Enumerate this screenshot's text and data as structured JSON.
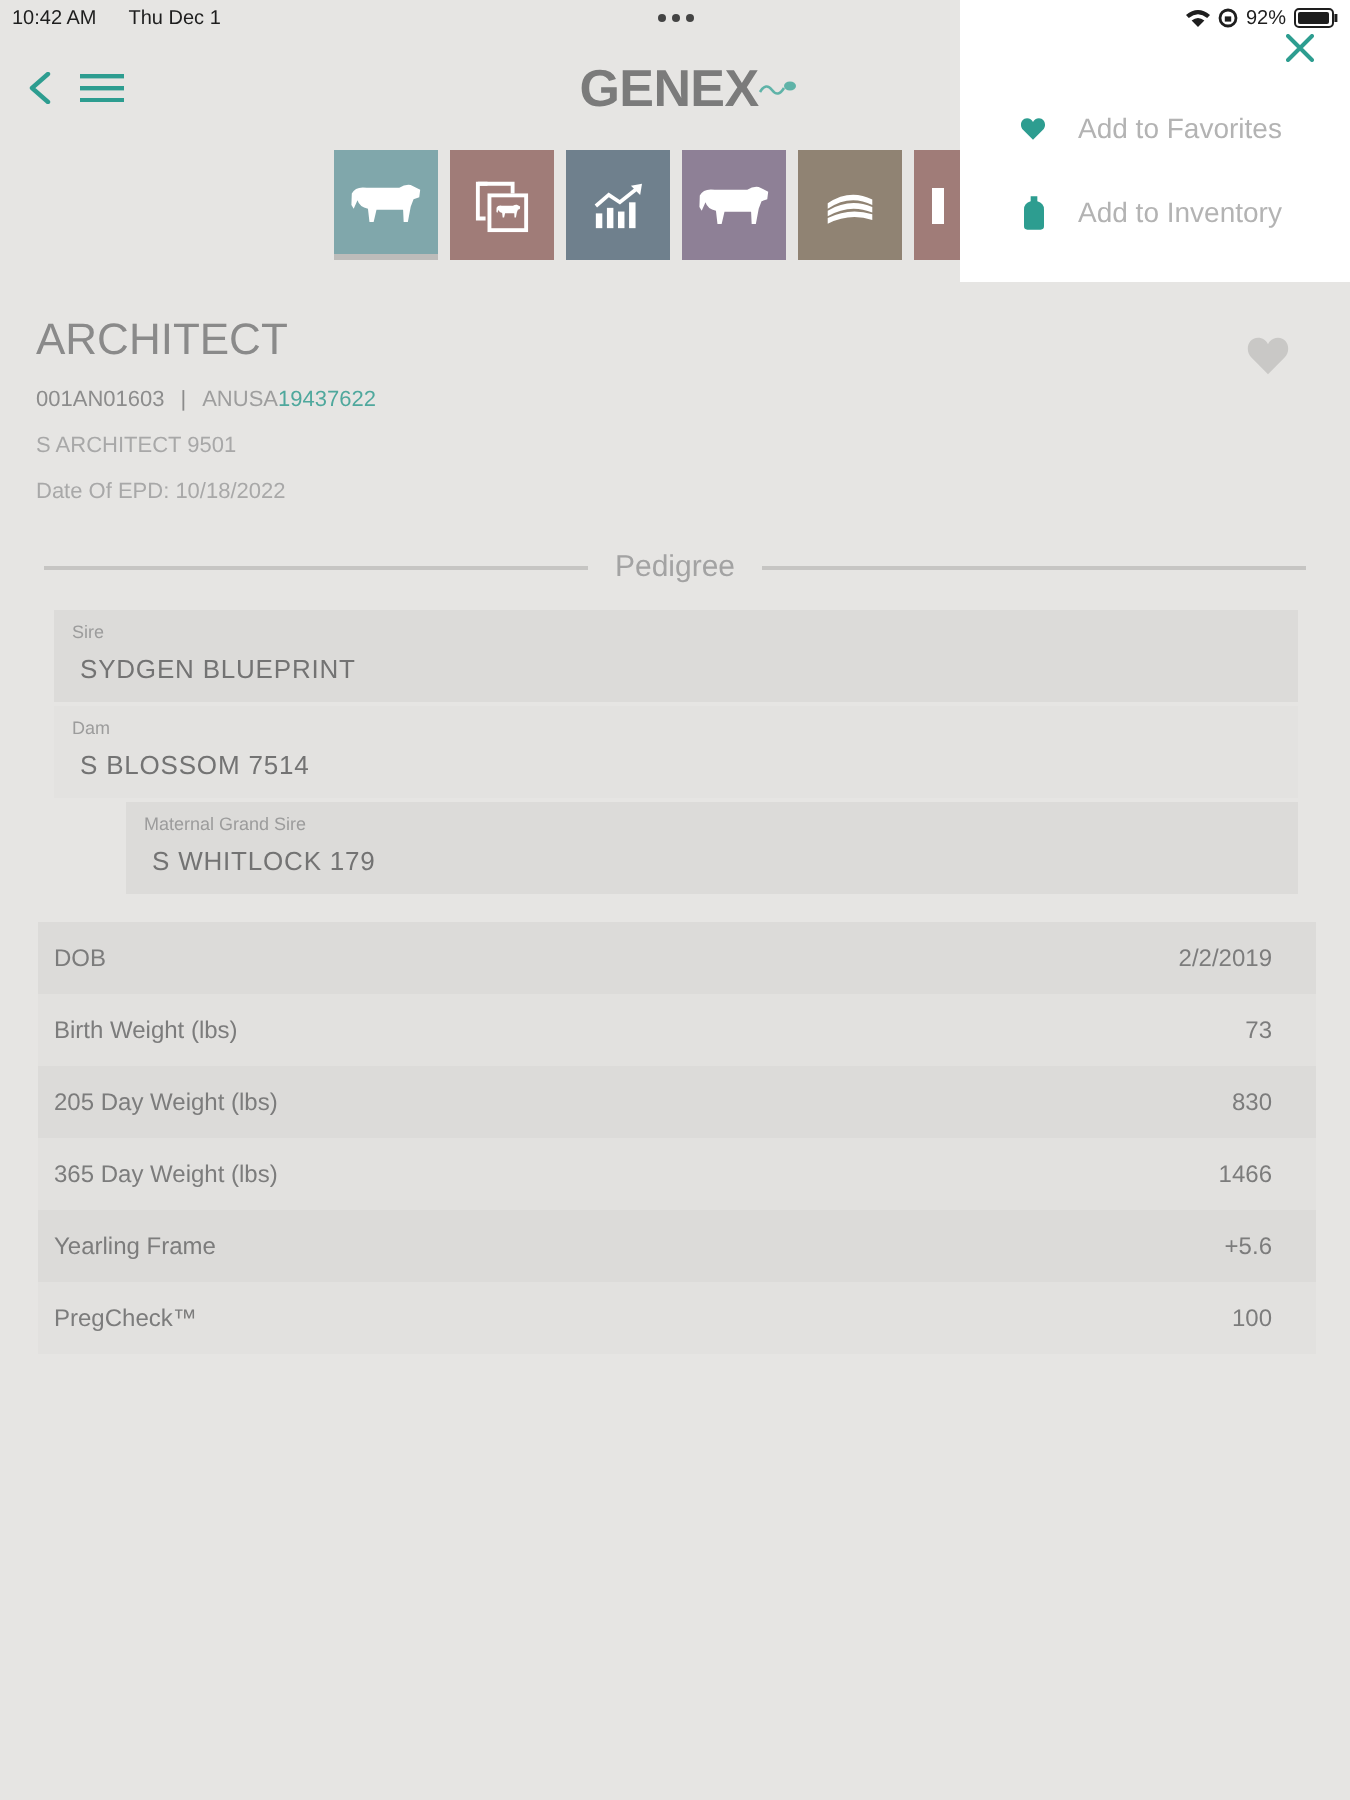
{
  "status_bar": {
    "time": "10:42 AM",
    "date": "Thu Dec 1",
    "battery": "92%"
  },
  "header": {
    "logo": "GENEX"
  },
  "tiles": [
    {
      "kind": "cow",
      "color": "#80a7ab",
      "selected": true
    },
    {
      "kind": "photos",
      "color": "#a07c78",
      "selected": false
    },
    {
      "kind": "chart",
      "color": "#6f808d",
      "selected": false
    },
    {
      "kind": "cow",
      "color": "#8e8096",
      "selected": false
    },
    {
      "kind": "stack",
      "color": "#908373",
      "selected": false
    },
    {
      "kind": "bar",
      "color": "#a07c78",
      "selected": false
    }
  ],
  "animal": {
    "name": "ARCHITECT",
    "id": "001AN01603",
    "separator": "|",
    "registration": {
      "prefix": "ANUSA",
      "number": "19437622"
    },
    "registered_name": "S ARCHITECT 9501",
    "epd_date": "Date Of EPD: 10/18/2022",
    "favorite": false
  },
  "pedigree": {
    "title": "Pedigree",
    "entries": [
      {
        "label": "Sire",
        "name": "SYDGEN BLUEPRINT"
      },
      {
        "label": "Dam",
        "name": "S BLOSSOM 7514",
        "children": [
          {
            "label": "Maternal Grand Sire",
            "name": "S WHITLOCK 179"
          }
        ]
      }
    ]
  },
  "stats": [
    {
      "label": "DOB",
      "value": "2/2/2019"
    },
    {
      "label": "Birth Weight (lbs)",
      "value": "73"
    },
    {
      "label": "205 Day Weight (lbs)",
      "value": "830"
    },
    {
      "label": "365 Day Weight (lbs)",
      "value": "1466"
    },
    {
      "label": "Yearling Frame",
      "value": "+5.6"
    },
    {
      "label": "PregCheck™",
      "value": "100"
    }
  ],
  "menu": {
    "items": [
      {
        "kind": "favorite",
        "label": "Add to Favorites"
      },
      {
        "kind": "inventory",
        "label": "Add to Inventory"
      }
    ]
  }
}
